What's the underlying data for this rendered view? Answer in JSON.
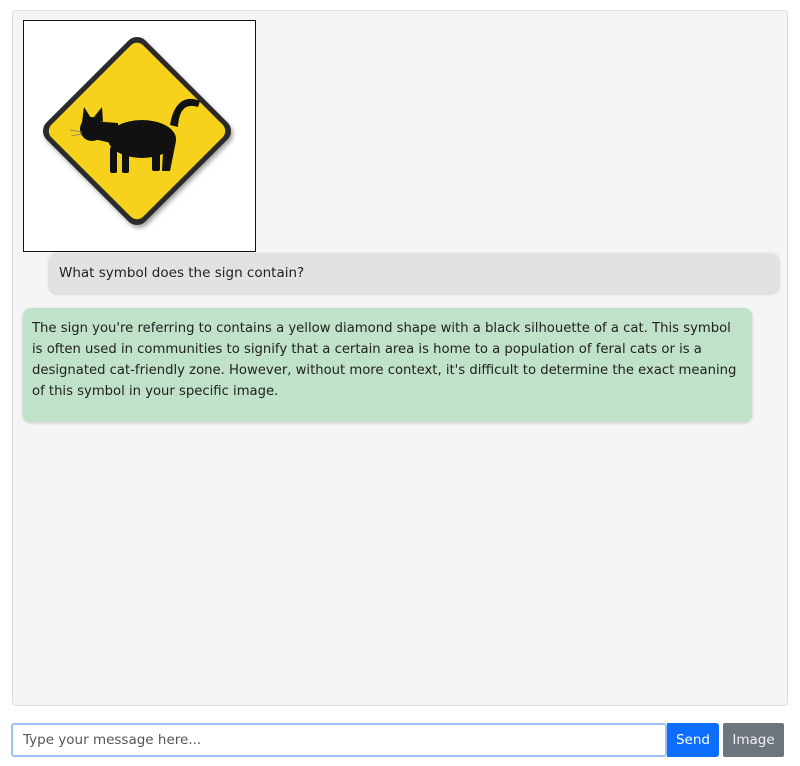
{
  "chat": {
    "messages": [
      {
        "role": "user",
        "type": "image",
        "icon": "cat-crossing-sign-icon",
        "colors": {
          "sign_fill": "#f7d21c",
          "sign_border": "#2a2a2a",
          "silhouette": "#111111"
        }
      },
      {
        "role": "user",
        "type": "text",
        "text": "What symbol does the sign contain?",
        "color": "#e2e2e2"
      },
      {
        "role": "assistant",
        "type": "text",
        "text": "The sign you're referring to contains a yellow diamond shape with a black silhouette of a cat. This symbol is often used in communities to signify that a certain area is home to a population of feral cats or is a designated cat-friendly zone. However, without more context, it's difficult to determine the exact meaning of this symbol in your specific image.",
        "color": "#bfe2c8"
      }
    ]
  },
  "composer": {
    "placeholder": "Type your message here...",
    "value": "",
    "send_label": "Send",
    "image_label": "Image",
    "send_color": "#0d6efd",
    "image_color": "#6c757d"
  }
}
